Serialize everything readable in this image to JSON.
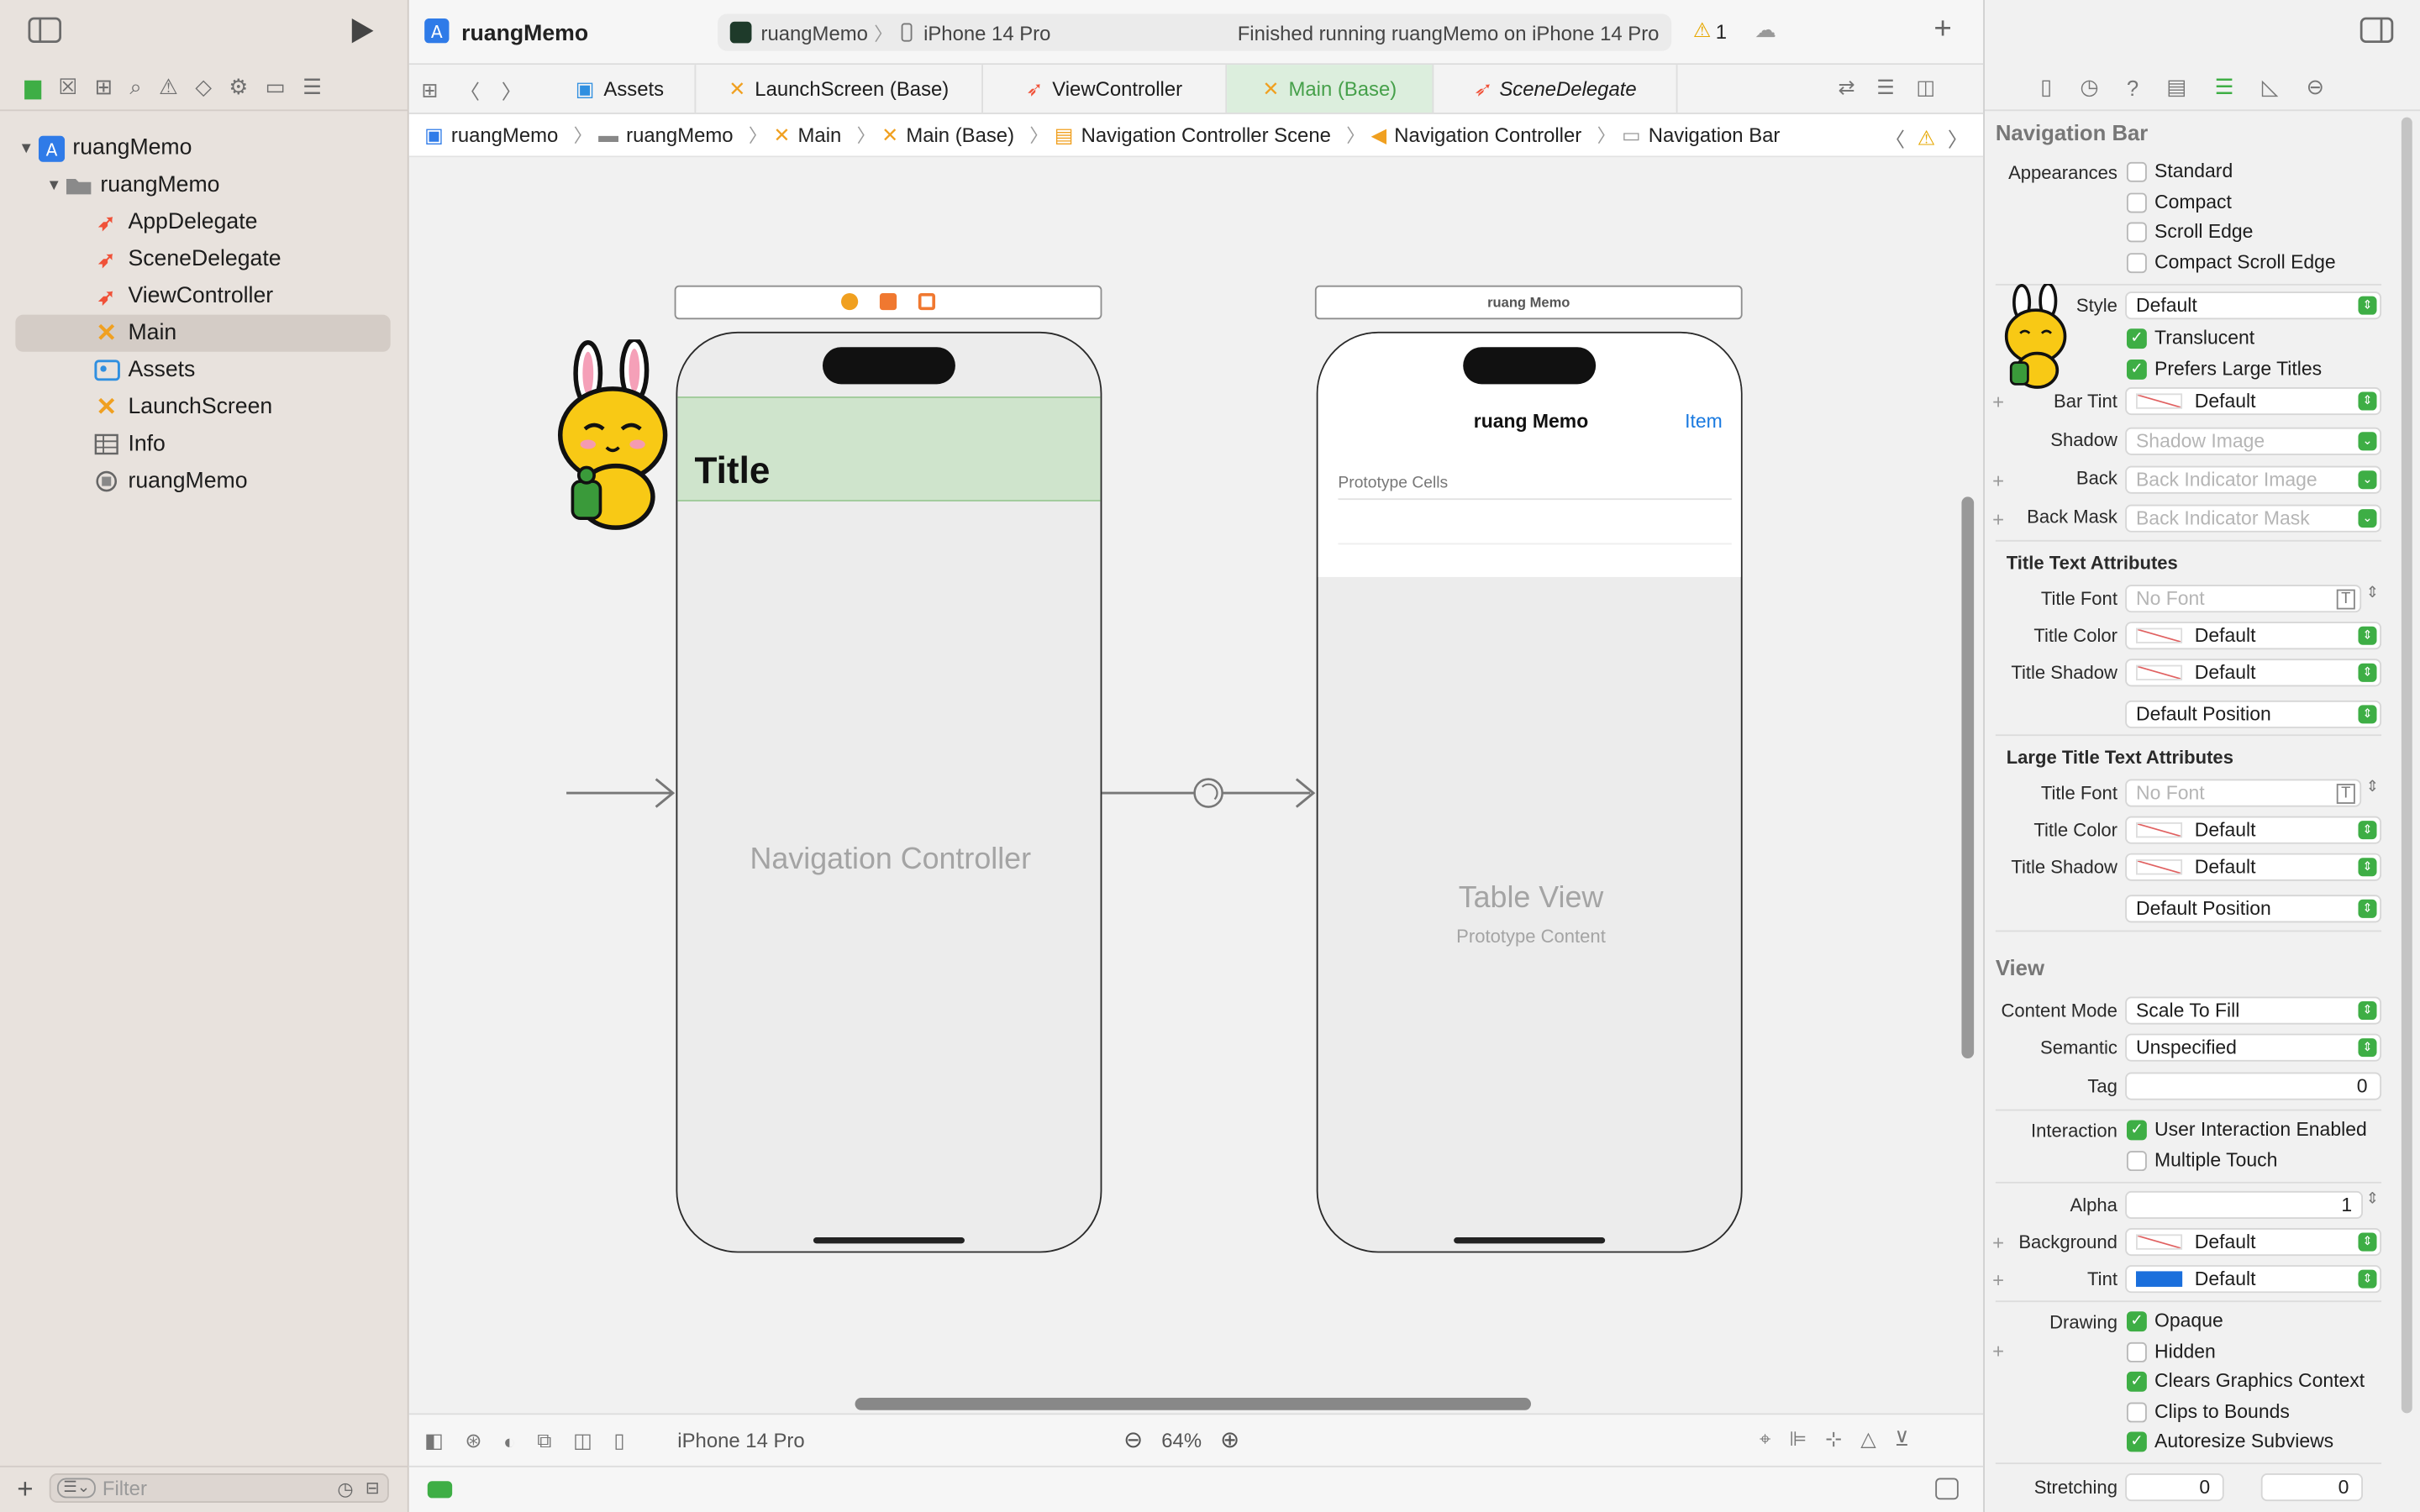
{
  "window": {
    "project_name": "ruangMemo",
    "scheme": "ruangMemo",
    "device": "iPhone 14 Pro",
    "status": "Finished running ruangMemo on iPhone 14 Pro",
    "warning_count": "1"
  },
  "sidebar": {
    "items": [
      {
        "label": "ruangMemo",
        "icon": "project-icon"
      },
      {
        "label": "ruangMemo",
        "icon": "folder-icon"
      },
      {
        "label": "AppDelegate",
        "icon": "swift-file-icon"
      },
      {
        "label": "SceneDelegate",
        "icon": "swift-file-icon"
      },
      {
        "label": "ViewController",
        "icon": "swift-file-icon"
      },
      {
        "label": "Main",
        "icon": "storyboard-icon"
      },
      {
        "label": "Assets",
        "icon": "asset-catalog-icon"
      },
      {
        "label": "LaunchScreen",
        "icon": "storyboard-icon"
      },
      {
        "label": "Info",
        "icon": "plist-icon"
      },
      {
        "label": "ruangMemo",
        "icon": "entitlements-icon"
      }
    ],
    "filter_placeholder": "Filter"
  },
  "tabs": [
    {
      "label": "Assets"
    },
    {
      "label": "LaunchScreen (Base)"
    },
    {
      "label": "ViewController"
    },
    {
      "label": "Main (Base)"
    },
    {
      "label": "SceneDelegate"
    }
  ],
  "breadcrumb": [
    "ruangMemo",
    "ruangMemo",
    "Main",
    "Main (Base)",
    "Navigation Controller Scene",
    "Navigation Controller",
    "Navigation Bar"
  ],
  "canvas": {
    "nav_controller": {
      "title": "Title",
      "label": "Navigation Controller"
    },
    "table_scene": {
      "bar_label": "ruang Memo",
      "nav_title": "ruang Memo",
      "nav_item": "Item",
      "section": "Prototype Cells",
      "label": "Table View",
      "sublabel": "Prototype Content"
    }
  },
  "bottombar": {
    "device": "iPhone 14 Pro",
    "zoom": "64%"
  },
  "inspector": {
    "section_title": "Navigation Bar",
    "appearances_label": "Appearances",
    "appearances": [
      {
        "label": "Standard",
        "checked": false
      },
      {
        "label": "Compact",
        "checked": false
      },
      {
        "label": "Scroll Edge",
        "checked": false
      },
      {
        "label": "Compact Scroll Edge",
        "checked": false
      }
    ],
    "style_label": "Style",
    "style_value": "Default",
    "translucent": "Translucent",
    "prefers_large": "Prefers Large Titles",
    "bar_tint_label": "Bar Tint",
    "bar_tint_value": "Default",
    "shadow_label": "Shadow",
    "shadow_placeholder": "Shadow Image",
    "back_label": "Back",
    "back_placeholder": "Back Indicator Image",
    "back_mask_label": "Back Mask",
    "back_mask_placeholder": "Back Indicator Mask",
    "title_text_head": "Title Text Attributes",
    "title_font_label": "Title Font",
    "title_font_placeholder": "No Font",
    "title_color_label": "Title Color",
    "title_color_value": "Default",
    "title_shadow_label": "Title Shadow",
    "title_shadow_value": "Default",
    "title_position_value": "Default Position",
    "large_text_head": "Large Title Text Attributes",
    "large_font_label": "Title Font",
    "large_font_placeholder": "No Font",
    "large_color_label": "Title Color",
    "large_color_value": "Default",
    "large_shadow_label": "Title Shadow",
    "large_shadow_value": "Default",
    "large_position_value": "Default Position",
    "view_head": "View",
    "content_mode_label": "Content Mode",
    "content_mode_value": "Scale To Fill",
    "semantic_label": "Semantic",
    "semantic_value": "Unspecified",
    "tag_label": "Tag",
    "tag_value": "0",
    "interaction_label": "Interaction",
    "user_interaction": "User Interaction Enabled",
    "multiple_touch": "Multiple Touch",
    "alpha_label": "Alpha",
    "alpha_value": "1",
    "background_label": "Background",
    "background_value": "Default",
    "tint_label": "Tint",
    "tint_value": "Default",
    "drawing_label": "Drawing",
    "opaque": "Opaque",
    "hidden": "Hidden",
    "clears": "Clears Graphics Context",
    "clips": "Clips to Bounds",
    "autoresize": "Autoresize Subviews",
    "stretching_label": "Stretching",
    "stretch_x": "0",
    "stretch_y": "0"
  },
  "colors": {
    "accent_green": "#3eae45",
    "tint_blue": "#1a6fdc",
    "nav_highlight": "#cfe4cc"
  }
}
